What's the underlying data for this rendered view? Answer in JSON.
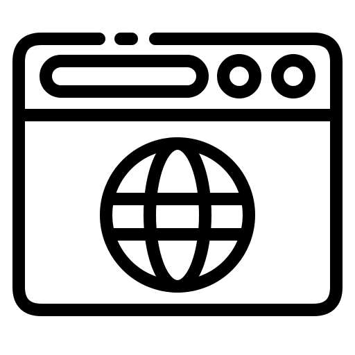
{
  "icon": {
    "name": "web-browser-globe-icon",
    "stroke_color": "#000000",
    "background_color": "#ffffff",
    "parts": [
      "browser-window-frame-icon",
      "address-bar",
      "window-control-dot",
      "globe-icon"
    ]
  }
}
